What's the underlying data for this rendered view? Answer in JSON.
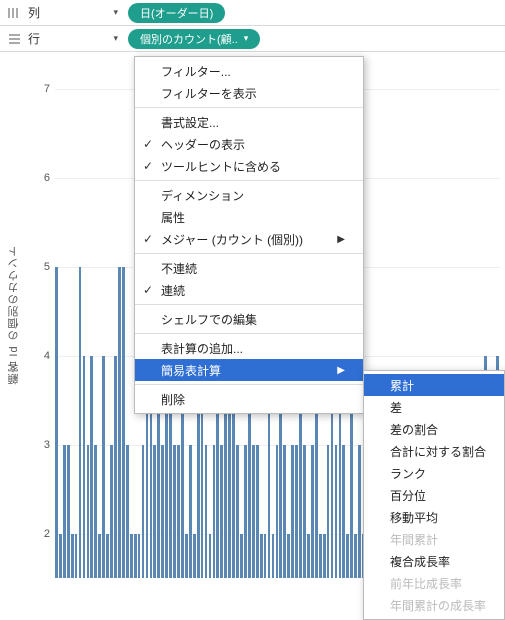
{
  "shelves": {
    "columns_label": "列",
    "rows_label": "行",
    "columns_pill": "日(オーダー日)",
    "rows_pill": "個別のカウント(顧.."
  },
  "axis": {
    "title": "顧客 Id の個別のカウント",
    "ticks": [
      "7",
      "6",
      "5",
      "4",
      "3",
      "2"
    ]
  },
  "chart_data": {
    "type": "bar",
    "xlabel": "日(オーダー日)",
    "ylabel": "顧客 Id の個別のカウント",
    "ylim": [
      1.5,
      7.3
    ],
    "values": [
      5,
      2,
      3,
      3,
      2,
      2,
      5,
      4,
      3,
      4,
      3,
      2,
      4,
      2,
      3,
      4,
      5,
      5,
      3,
      2,
      2,
      2,
      3,
      4,
      4,
      3,
      4,
      3,
      4,
      4,
      3,
      3,
      4,
      2,
      3,
      2,
      4,
      4,
      3,
      2,
      3,
      4,
      3,
      4,
      5,
      4,
      3,
      2,
      3,
      4,
      3,
      3,
      2,
      2,
      4,
      2,
      3,
      4,
      3,
      2,
      3,
      3,
      4,
      3,
      2,
      3,
      4,
      2,
      2,
      3,
      4,
      3,
      4,
      3,
      2,
      4,
      2,
      3,
      2,
      2,
      3,
      2,
      3,
      2,
      3,
      2,
      3,
      2,
      2,
      2,
      3,
      2,
      3,
      2,
      3,
      2,
      2,
      2,
      3,
      2,
      2,
      3,
      2,
      3,
      2,
      3,
      2,
      2,
      3,
      4,
      3,
      2,
      4
    ]
  },
  "menu": {
    "filter": "フィルター...",
    "show_filter": "フィルターを表示",
    "format": "書式設定...",
    "show_header": "ヘッダーの表示",
    "tooltip": "ツールヒントに含める",
    "dimension": "ディメンション",
    "attribute": "属性",
    "measure": "メジャー (カウント (個別))",
    "discrete": "不連続",
    "continuous": "連続",
    "edit_shelf": "シェルフでの編集",
    "add_table_calc": "表計算の追加...",
    "quick_table_calc": "簡易表計算",
    "remove": "削除"
  },
  "submenu": {
    "running_total": "累計",
    "difference": "差",
    "pct_difference": "差の割合",
    "pct_of_total": "合計に対する割合",
    "rank": "ランク",
    "percentile": "百分位",
    "moving_avg": "移動平均",
    "ytd_total": "年間累計",
    "cagr": "複合成長率",
    "yoy_growth": "前年比成長率",
    "ytd_growth": "年間累計の成長率"
  }
}
